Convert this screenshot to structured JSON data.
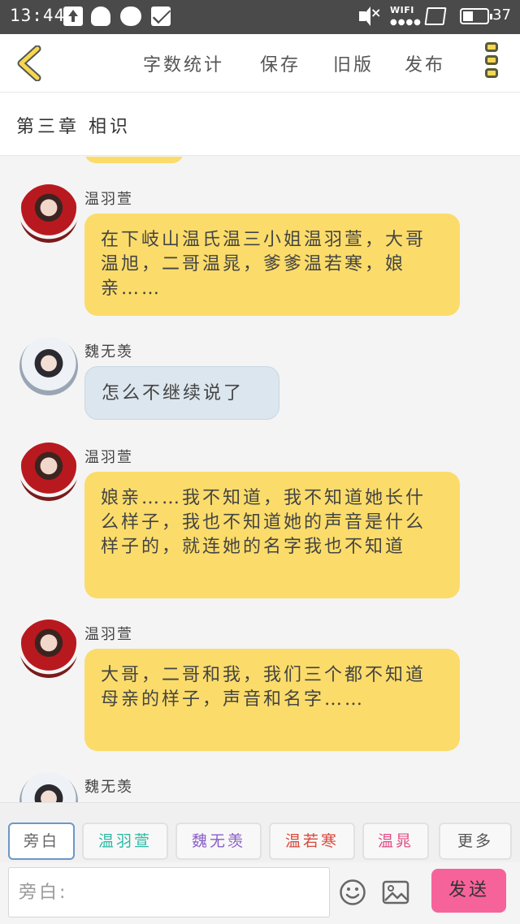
{
  "status_bar": {
    "time": "13:44",
    "wifi_label": "WIFI",
    "battery": "37"
  },
  "toolbar": {
    "word_count": "字数统计",
    "save": "保存",
    "old_version": "旧版",
    "publish": "发布"
  },
  "chapter": {
    "title": "第三章  相识"
  },
  "messages": [
    {
      "sender": "温羽萱",
      "text": "在下岐山温氏温三小姐温羽萱，大哥温旭，二哥温晁，爹爹温若寒，娘亲……",
      "bubble_color": "#fbdc6a"
    },
    {
      "sender": "魏无羡",
      "text": "怎么不继续说了",
      "bubble_color": "#dce6ee"
    },
    {
      "sender": "温羽萱",
      "text": "娘亲……我不知道，我不知道她长什么样子，我也不知道她的声音是什么样子的，就连她的名字我也不知道",
      "bubble_color": "#fbdc6a"
    },
    {
      "sender": "温羽萱",
      "text": "大哥，二哥和我，我们三个都不知道母亲的样子，声音和名字……",
      "bubble_color": "#fbdc6a"
    },
    {
      "sender": "魏无羡",
      "text": "",
      "bubble_color": "#dce6ee"
    }
  ],
  "roles": {
    "narration": "旁白",
    "role_1": "温羽萱",
    "role_2": "魏无羡",
    "role_3": "温若寒",
    "role_4": "温晁",
    "more": "更多",
    "colors": {
      "role_1": "#2fb9a6",
      "role_2": "#8a5fc6",
      "role_3": "#d84a3c",
      "role_4": "#e14d86"
    }
  },
  "input": {
    "placeholder": "旁白:",
    "value": ""
  },
  "send_button": "发送",
  "icons": {
    "back": "chevron-left-icon",
    "menu": "more-vertical-icon",
    "emoji": "smiley-icon",
    "image": "image-icon"
  }
}
